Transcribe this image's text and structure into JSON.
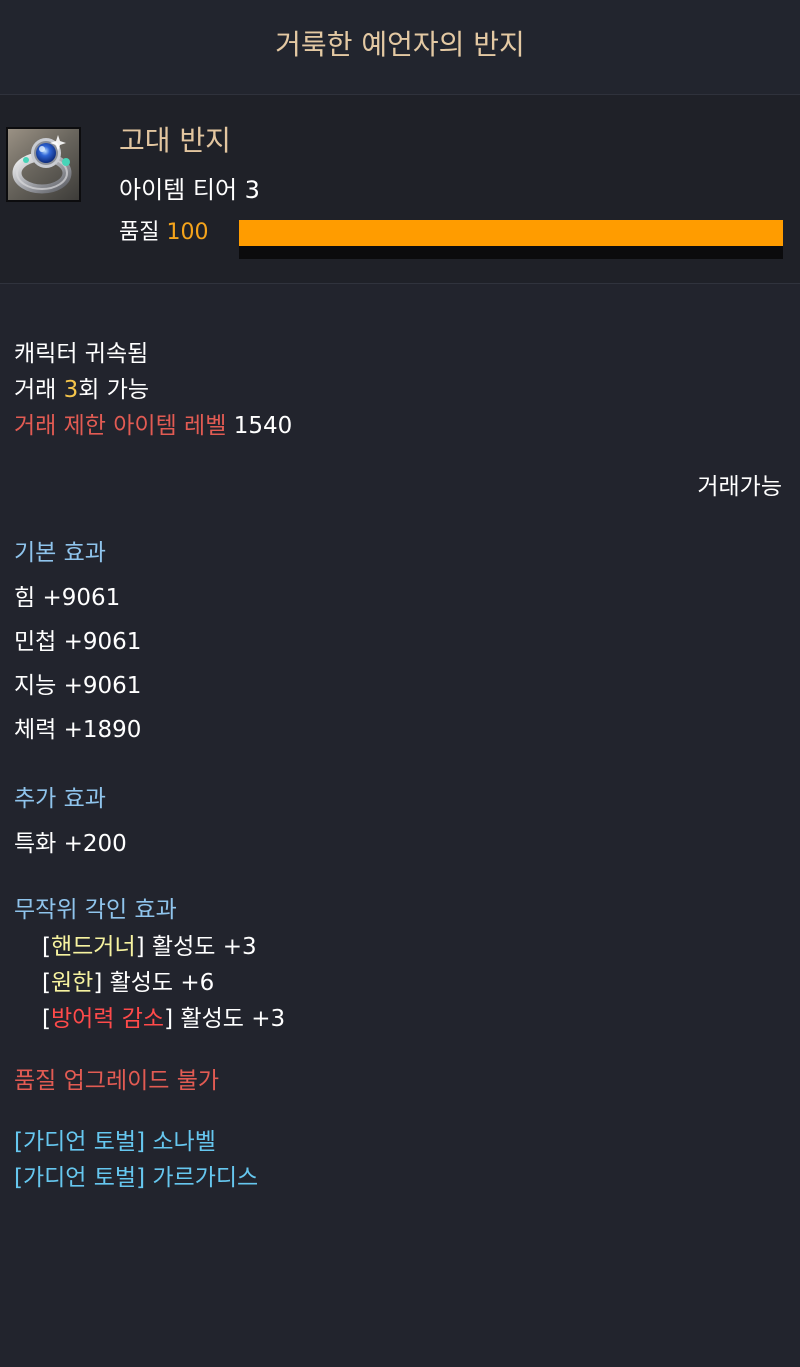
{
  "title": "거룩한 예언자의 반지",
  "item": {
    "icon": "ring-icon",
    "grade": "고대 반지",
    "tier": "아이템 티어 3",
    "quality_label": "품질",
    "quality_value": "100",
    "quality_percent": 100,
    "quality_color": "#ff9c00"
  },
  "binding": {
    "bound_text": "캐릭터 귀속됨",
    "trade_prefix": "거래 ",
    "trade_count": "3",
    "trade_suffix": "회 가능",
    "trade_limit_label": "거래 제한 아이템 레벨",
    "trade_limit_value": "1540",
    "tradable": "거래가능"
  },
  "basic_effects": {
    "title": "기본 효과",
    "stats": [
      "힘 +9061",
      "민첩 +9061",
      "지능 +9061",
      "체력 +1890"
    ]
  },
  "additional_effects": {
    "title": "추가 효과",
    "stats": [
      "특화 +200"
    ]
  },
  "engravings": {
    "title": "무작위 각인 효과",
    "items": [
      {
        "name": "핸드거너",
        "activation": "활성도 +3",
        "color": "#f7f3a0"
      },
      {
        "name": "원한",
        "activation": "활성도 +6",
        "color": "#f7f3a0"
      },
      {
        "name": "방어력 감소",
        "activation": "활성도 +3",
        "color": "#ff4a4a"
      }
    ]
  },
  "upgrade_note": "품질 업그레이드 불가",
  "source_notes": [
    "[가디언 토벌] 소나벨",
    "[가디언 토벌] 가르가디스"
  ]
}
